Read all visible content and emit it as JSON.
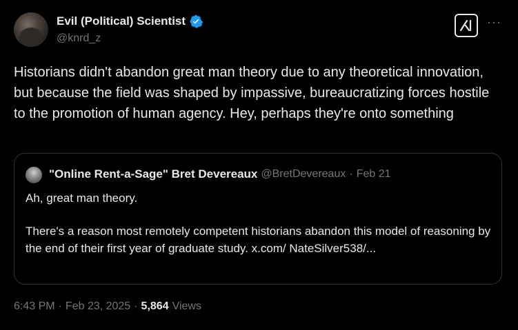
{
  "author": {
    "display_name": "Evil (Political) Scientist",
    "handle": "@knrd_z"
  },
  "icons": {
    "verified": "verified-badge-icon",
    "grok": "grok-icon",
    "more": "more-icon"
  },
  "colors": {
    "background": "#000000",
    "text": "#e7e9ea",
    "secondary": "#71767b",
    "verified": "#1d9bf0",
    "border": "#2f3336"
  },
  "more_label": "···",
  "tweet": {
    "text": "Historians didn't abandon great man theory due to any theoretical innovation, but because the field was shaped by impassive, bureaucratizing forces hostile to the promotion of human agency. Hey, perhaps they're onto something"
  },
  "quote": {
    "display_name": "\"Online Rent-a-Sage\" Bret Devereaux",
    "handle": "@BretDevereaux",
    "separator": "·",
    "date": "Feb 21",
    "line1": "Ah, great man theory.",
    "body": "There's a reason most remotely competent historians abandon this model of reasoning by the end of their first year of graduate study. x.com/ NateSilver538/..."
  },
  "meta": {
    "time": "6:43 PM",
    "separator1": "·",
    "date": "Feb 23, 2025",
    "separator2": "·",
    "views_count": "5,864",
    "views_label": "Views"
  }
}
